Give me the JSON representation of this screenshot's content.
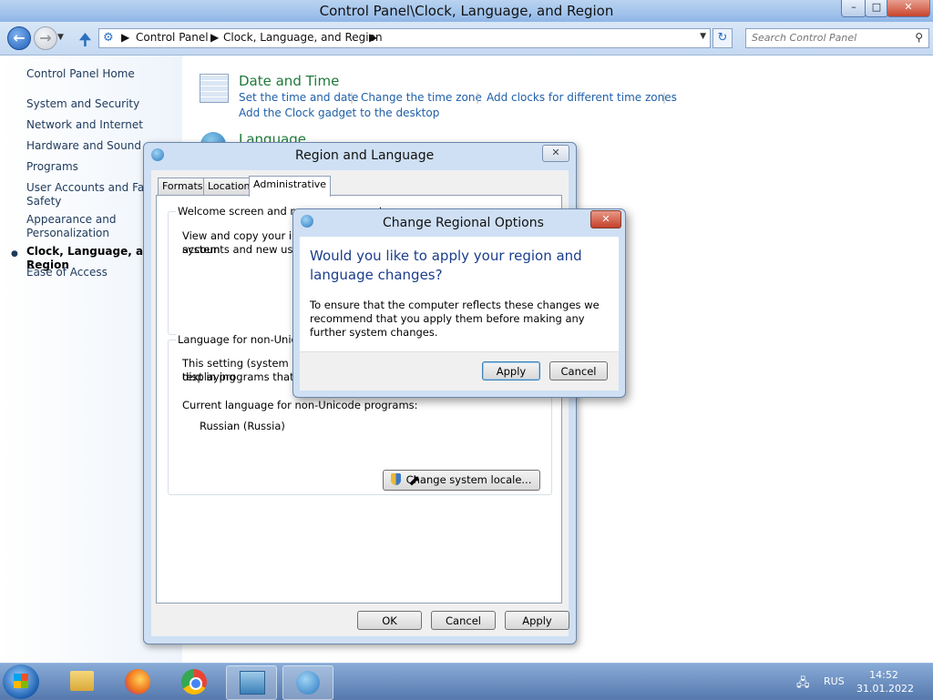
{
  "window": {
    "title": "Control Panel\\Clock, Language, and Region",
    "min_label": "–",
    "max_label": "□",
    "close_label": "✕"
  },
  "nav": {
    "back_glyph": "←",
    "fwd_glyph": "→",
    "breadcrumbs": [
      "Control Panel",
      "Clock, Language, and Region"
    ],
    "crumb_sep": "▶",
    "search_placeholder": "Search Control Panel"
  },
  "sidebar": {
    "items": [
      "Control Panel Home",
      "System and Security",
      "Network and Internet",
      "Hardware and Sound",
      "Programs",
      "User Accounts and Family Safety",
      "Appearance and Personalization",
      "Clock, Language, and Region",
      "Ease of Access"
    ]
  },
  "content": {
    "date_time": {
      "heading": "Date and Time",
      "links": [
        "Set the time and date",
        "Change the time zone",
        "Add clocks for different time zones",
        "Add the Clock gadget to the desktop"
      ]
    },
    "language": {
      "heading": "Language"
    }
  },
  "region_dialog": {
    "title": "Region and Language",
    "close_label": "✕",
    "tabs": [
      "Formats",
      "Location",
      "Administrative"
    ],
    "active_tab": "Administrative",
    "welcome_group": {
      "label": "Welcome screen and new user accounts",
      "text": [
        "View and copy your international settings to the welcome screen, system",
        "accounts and new user accounts."
      ]
    },
    "nonunicode_group": {
      "label": "Language for non-Unicode programs",
      "text": [
        "This setting (system locale) controls the language used when displaying",
        "text in programs that do not support Unicode."
      ],
      "current_label": "Current language for non-Unicode programs:",
      "current_value": "Russian (Russia)",
      "button": "Change system locale..."
    },
    "buttons": {
      "ok": "OK",
      "cancel": "Cancel",
      "apply": "Apply"
    }
  },
  "confirm_dialog": {
    "title": "Change Regional Options",
    "close_label": "✕",
    "question": "Would you like to apply your region and language changes?",
    "info": "To ensure that the computer reflects these changes we recommend that you apply them before making any further system changes.",
    "apply": "Apply",
    "cancel": "Cancel"
  },
  "taskbar": {
    "tray_lang": "RUS",
    "time": "14:52",
    "date": "31.01.2022"
  }
}
